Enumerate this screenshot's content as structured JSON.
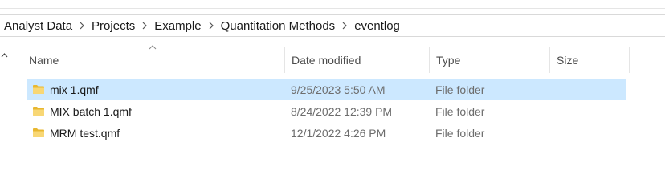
{
  "breadcrumb": {
    "items": [
      "Analyst Data",
      "Projects",
      "Example",
      "Quantitation Methods",
      "eventlog"
    ]
  },
  "columns": {
    "name": "Name",
    "date_modified": "Date modified",
    "type": "Type",
    "size": "Size"
  },
  "files": [
    {
      "name": "mix 1.qmf",
      "date_modified": "9/25/2023 5:50 AM",
      "type": "File folder",
      "selected": true
    },
    {
      "name": "MIX batch 1.qmf",
      "date_modified": "8/24/2022 12:39 PM",
      "type": "File folder",
      "selected": false
    },
    {
      "name": "MRM test.qmf",
      "date_modified": "12/1/2022 4:26 PM",
      "type": "File folder",
      "selected": false
    }
  ],
  "colors": {
    "selection": "#cce8ff",
    "folder": "#e8b730"
  },
  "icons": {
    "folder": "folder-icon",
    "separator": "chevron-right-icon",
    "sort": "sort-ascending-icon",
    "scroll": "scroll-up-icon"
  }
}
